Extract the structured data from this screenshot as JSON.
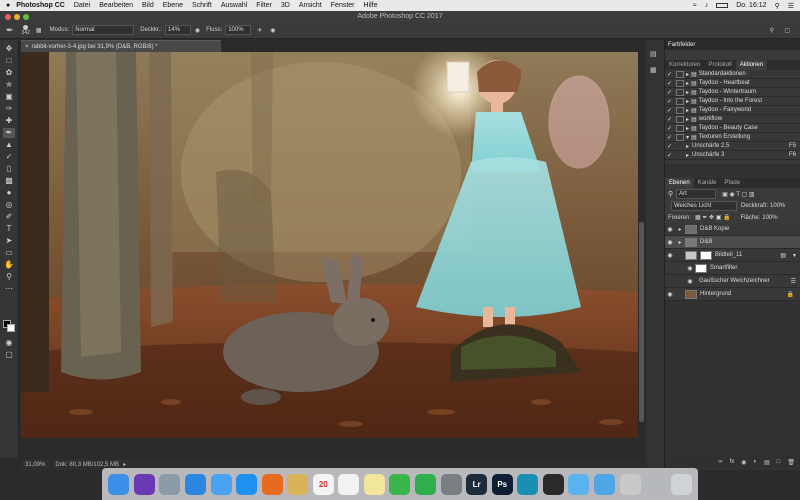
{
  "menubar": {
    "app": "Photoshop CC",
    "items": [
      "Datei",
      "Bearbeiten",
      "Bild",
      "Ebene",
      "Schrift",
      "Auswahl",
      "Filter",
      "3D",
      "Ansicht",
      "Fenster",
      "Hilfe"
    ],
    "clock": "Do. 16:12"
  },
  "window": {
    "title": "Adobe Photoshop CC 2017"
  },
  "options": {
    "brush_size": "342",
    "mode_label": "Modus:",
    "mode_value": "Normal",
    "opacity_label": "Deckkr.:",
    "opacity_value": "14%",
    "flow_label": "Fluss:",
    "flow_value": "100%"
  },
  "document": {
    "tab_label": "rabbit-vorher-3-4.jpg bei 31,9% (D&B, RGB/8) *",
    "status_zoom": "31,09%",
    "status_doc": "Dok: 80,3 MB/102,5 MB"
  },
  "panels": {
    "farbfelder": "Farbfelder",
    "action_tabs": [
      "Korrekturen",
      "Protokoll",
      "Aktionen"
    ],
    "actions": [
      {
        "label": "Standardaktionen",
        "indent": 0
      },
      {
        "label": "Taydoo - Heartbeat",
        "indent": 0
      },
      {
        "label": "Taydoo - Wintertraum",
        "indent": 0
      },
      {
        "label": "Taydoo - Into the Forest",
        "indent": 0
      },
      {
        "label": "Taydoo - Fairyworld",
        "indent": 0
      },
      {
        "label": "workflow",
        "indent": 0
      },
      {
        "label": "Taydoo - Beauty Case",
        "indent": 0
      },
      {
        "label": "Texturen Erstellung",
        "indent": 0
      },
      {
        "label": "Unschärfe 2,5",
        "indent": 1,
        "shortcut": "F5"
      },
      {
        "label": "Unschärfe 3",
        "indent": 1,
        "shortcut": "F6"
      }
    ],
    "layer_tabs": [
      "Ebenen",
      "Kanäle",
      "Pfade"
    ],
    "kind_filter": "Art",
    "blend_mode": "Weiches Licht",
    "opacity_label": "Deckkraft:",
    "opacity_value": "100%",
    "lock_label": "Fixieren:",
    "fill_label": "Fläche:",
    "fill_value": "100%",
    "layers": [
      {
        "name": "D&B Kopie",
        "kind": "normal"
      },
      {
        "name": "D&B",
        "kind": "normal"
      },
      {
        "name": "Bildteil_11",
        "kind": "smart"
      },
      {
        "name": "Smartfilter",
        "kind": "sub"
      },
      {
        "name": "Gaußscher Weichzeichner",
        "kind": "sub"
      },
      {
        "name": "Hintergrund",
        "kind": "locked"
      }
    ]
  },
  "dock": {
    "apps": [
      {
        "icon": "finder-icon",
        "label": "",
        "color": "#3b8fe6"
      },
      {
        "icon": "siri-icon",
        "label": "",
        "color": "#6a3ab4"
      },
      {
        "icon": "launchpad-icon",
        "label": "",
        "color": "#8a9aa8"
      },
      {
        "icon": "safari-icon",
        "label": "",
        "color": "#2a86e0"
      },
      {
        "icon": "mail-icon",
        "label": "",
        "color": "#4aa3f0"
      },
      {
        "icon": "appstore-icon",
        "label": "",
        "color": "#1f8ff0"
      },
      {
        "icon": "firefox-icon",
        "label": "",
        "color": "#e66b1f"
      },
      {
        "icon": "notes-icon",
        "label": "",
        "color": "#d8b35a"
      },
      {
        "icon": "calendar-icon",
        "label": "20",
        "color": "#f4f4f4"
      },
      {
        "icon": "reminders-icon",
        "label": "",
        "color": "#f2f2f2"
      },
      {
        "icon": "stickies-icon",
        "label": "",
        "color": "#f1e69a"
      },
      {
        "icon": "messages-icon",
        "label": "",
        "color": "#3ab54a"
      },
      {
        "icon": "facetime-icon",
        "label": "",
        "color": "#2fae4c"
      },
      {
        "icon": "preferences-icon",
        "label": "",
        "color": "#7a7d82"
      },
      {
        "icon": "lightroom-icon",
        "label": "Lr",
        "color": "#1d2b3a"
      },
      {
        "icon": "photoshop-icon",
        "label": "Ps",
        "color": "#0f1e34"
      },
      {
        "icon": "search-icon",
        "label": "",
        "color": "#1a8fb4"
      },
      {
        "icon": "quicktime-icon",
        "label": "",
        "color": "#2a2a2a"
      },
      {
        "icon": "folder-icon",
        "label": "",
        "color": "#5ab3ee"
      },
      {
        "icon": "folder-icon",
        "label": "",
        "color": "#4ea6e6"
      },
      {
        "icon": "documents-icon",
        "label": "",
        "color": "#c9c9c9"
      },
      {
        "icon": "monitor-icon",
        "label": "",
        "color": "#b5b8bd"
      },
      {
        "icon": "trash-icon",
        "label": "",
        "color": "#cfd3d8"
      }
    ]
  },
  "colors": {
    "accent": "#2d8ceb",
    "selected_layer": "#4b4b4b"
  }
}
